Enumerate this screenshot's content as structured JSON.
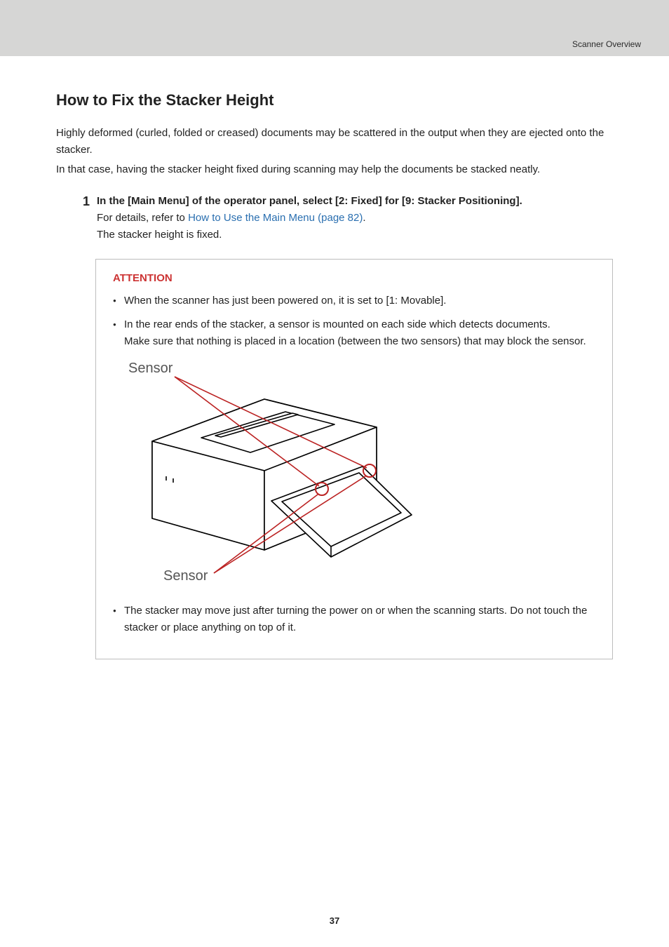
{
  "breadcrumb": "Scanner Overview",
  "heading": "How to Fix the Stacker Height",
  "intro_p1": "Highly deformed (curled, folded or creased) documents may be scattered in the output when they are ejected onto the stacker.",
  "intro_p2": "In that case, having the stacker height fixed during scanning may help the documents be stacked neatly.",
  "step": {
    "num": "1",
    "title": "In the [Main Menu] of the operator panel, select [2: Fixed] for [9: Stacker Positioning].",
    "detail_prefix": "For details, refer to ",
    "detail_link": "How to Use the Main Menu (page 82)",
    "detail_suffix": ".",
    "result": "The stacker height is fixed."
  },
  "attention": {
    "title": "ATTENTION",
    "b1": "When the scanner has just been powered on, it is set to [1: Movable].",
    "b2a": "In the rear ends of the stacker, a sensor is mounted on each side which detects documents.",
    "b2b": "Make sure that nothing is placed in a location (between the two sensors) that may block the sensor.",
    "b3": "The stacker may move just after turning the power on or when the scanning starts. Do not touch the stacker or place anything on top of it."
  },
  "diagram": {
    "label_top": "Sensor",
    "label_bottom": "Sensor"
  },
  "page_number": "37"
}
